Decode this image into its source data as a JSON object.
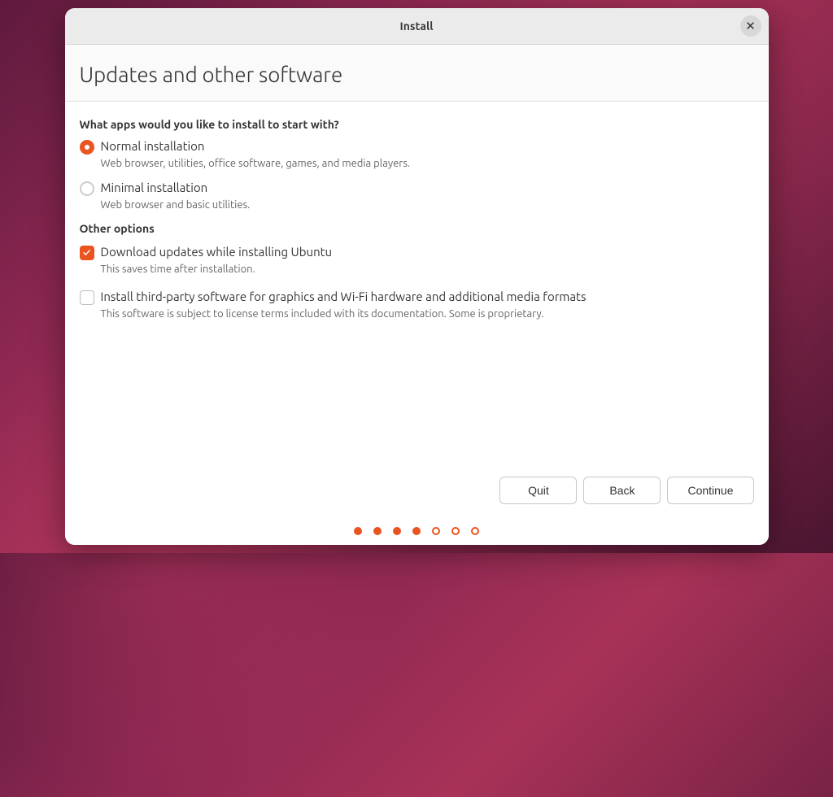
{
  "window": {
    "title": "Install"
  },
  "page": {
    "title": "Updates and other software"
  },
  "sections": {
    "apps_question": "What apps would you like to install to start with?",
    "other_options": "Other options"
  },
  "install_type": {
    "normal": {
      "label": "Normal installation",
      "desc": "Web browser, utilities, office software, games, and media players.",
      "selected": true
    },
    "minimal": {
      "label": "Minimal installation",
      "desc": "Web browser and basic utilities.",
      "selected": false
    }
  },
  "options": {
    "download_updates": {
      "label": "Download updates while installing Ubuntu",
      "desc": "This saves time after installation.",
      "checked": true
    },
    "third_party": {
      "label": "Install third-party software for graphics and Wi-Fi hardware and additional media formats",
      "desc": "This software is subject to license terms included with its documentation. Some is proprietary.",
      "checked": false
    }
  },
  "buttons": {
    "quit": "Quit",
    "back": "Back",
    "continue": "Continue"
  },
  "progress": {
    "total": 7,
    "current": 4
  },
  "colors": {
    "accent": "#e95420"
  }
}
